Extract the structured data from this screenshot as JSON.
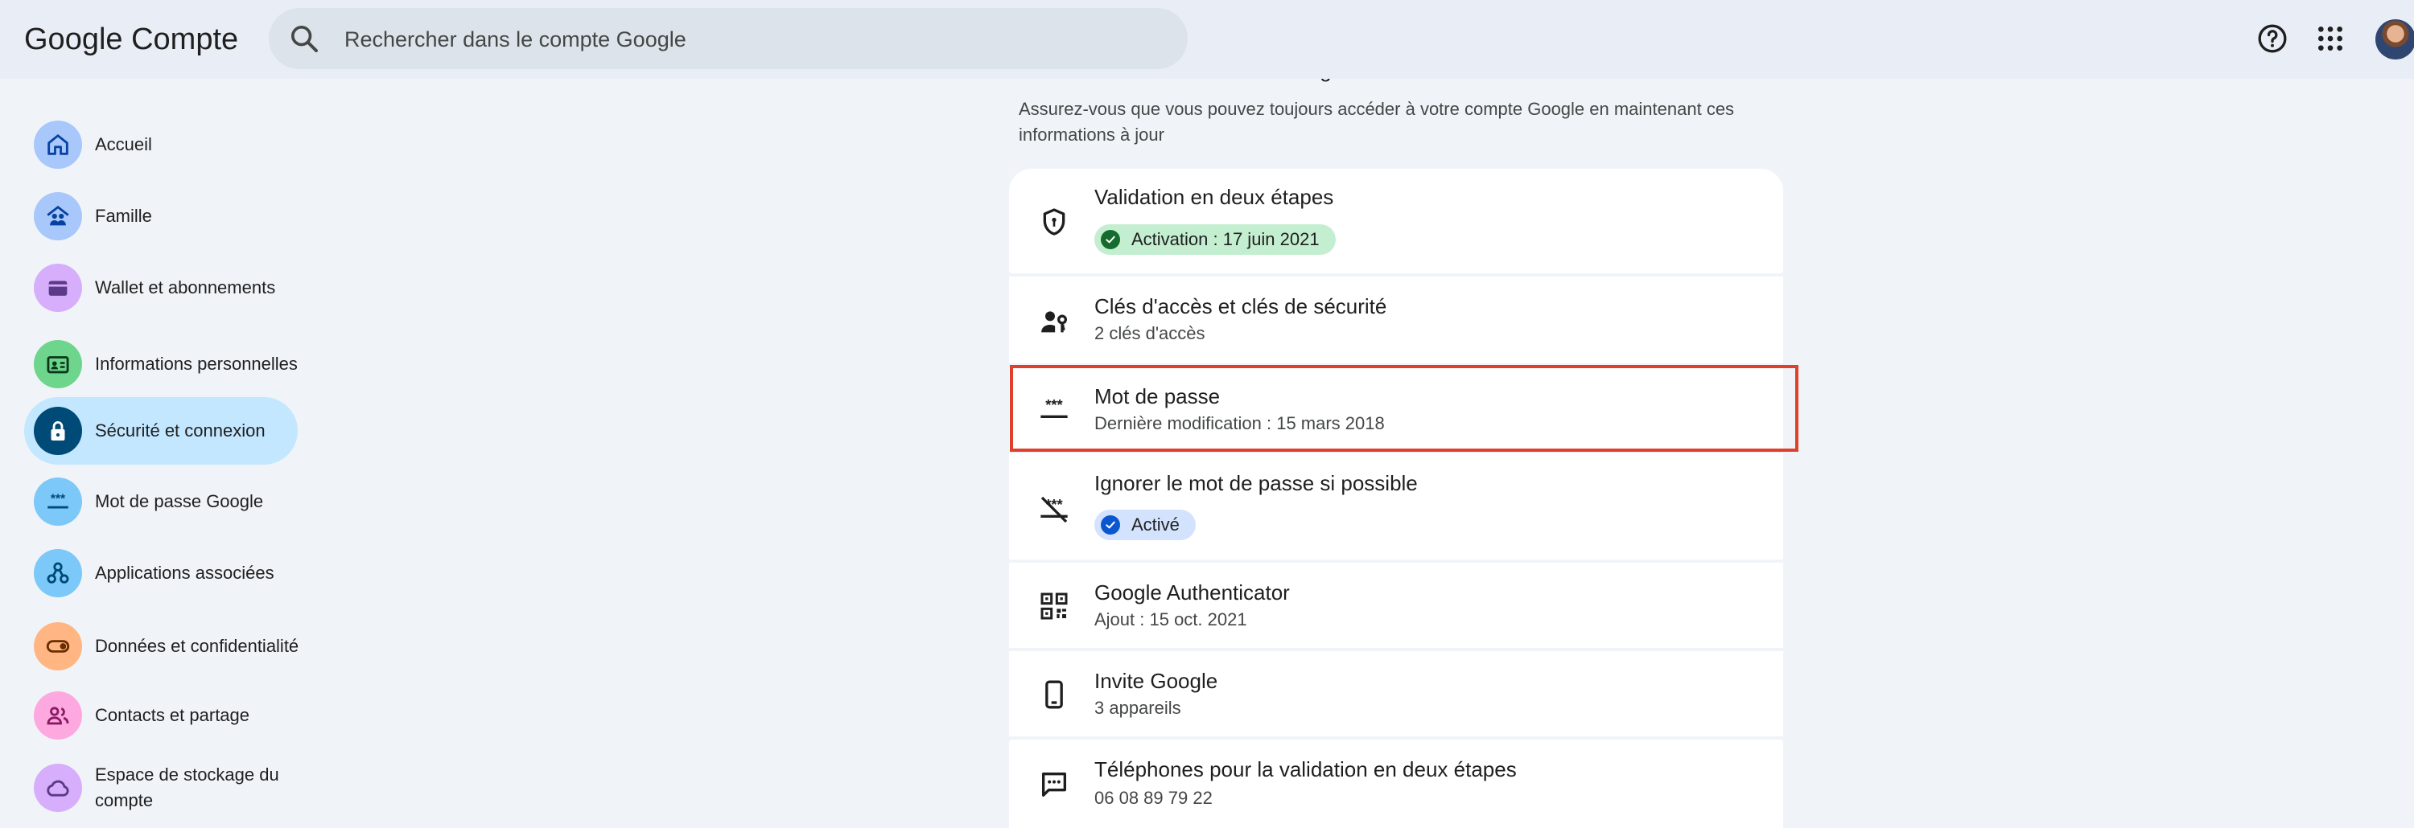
{
  "header": {
    "logo_google": "Google",
    "logo_product": "Compte",
    "search_placeholder": "Rechercher dans le compte Google",
    "icons": [
      "search-icon",
      "help-icon",
      "apps-grid-icon",
      "avatar"
    ]
  },
  "sidebar": {
    "items": [
      {
        "label": "Accueil",
        "icon": "home-icon",
        "color": "#a8c7fa",
        "active": false
      },
      {
        "label": "Famille",
        "icon": "family-icon",
        "color": "#a8c7fa",
        "active": false
      },
      {
        "label": "Wallet et abonnements",
        "icon": "wallet-icon",
        "color": "#d7aefb",
        "active": false
      },
      {
        "label": "Informations personnelles",
        "icon": "id-card-icon",
        "color": "#6dd58c",
        "active": false
      },
      {
        "label": "Sécurité et connexion",
        "icon": "lock-icon",
        "color": "#004a77",
        "active": true
      },
      {
        "label": "Mot de passe Google",
        "icon": "password-icon",
        "color": "#7cc8f8",
        "active": false
      },
      {
        "label": "Applications associées",
        "icon": "connected-apps-icon",
        "color": "#7cc8f8",
        "active": false
      },
      {
        "label": "Données et confidentialité",
        "icon": "toggle-icon",
        "color": "#ffb683",
        "active": false
      },
      {
        "label": "Contacts et partage",
        "icon": "people-icon",
        "color": "#fda9df",
        "active": false
      },
      {
        "label": "Espace de stockage du compte",
        "icon": "cloud-icon",
        "color": "#d7aefb",
        "active": false
      }
    ]
  },
  "main": {
    "section_heading": "Comment vous connecter à Google",
    "section_subtitle": "Assurez-vous que vous pouvez toujours accéder à votre compte Google en maintenant ces informations à jour",
    "rows": [
      {
        "title": "Validation en deux étapes",
        "chip": "Activation : 17 juin 2021",
        "chip_color": "#c4eed0",
        "chip_icon_color": "#146c2e",
        "icon": "shield-icon"
      },
      {
        "title": "Clés d'accès et clés de sécurité",
        "subtitle": "2 clés d'accès",
        "icon": "passkey-icon"
      },
      {
        "title": "Mot de passe",
        "subtitle": "Dernière modification : 15 mars 2018",
        "icon": "password-dots-icon"
      },
      {
        "title": "Ignorer le mot de passe si possible",
        "chip": "Activé",
        "chip_color": "#d3e3fd",
        "chip_icon_color": "#0b57d0",
        "icon": "password-off-icon"
      },
      {
        "title": "Google Authenticator",
        "subtitle": "Ajout : 15 oct. 2021",
        "icon": "qr-code-icon"
      },
      {
        "title": "Invite Google",
        "subtitle": "3 appareils",
        "icon": "phone-icon"
      },
      {
        "title": "Téléphones pour la validation en deux étapes",
        "subtitle": "06 08 89 79 22",
        "icon": "sms-icon"
      }
    ],
    "highlight_color": "#e0402b"
  }
}
